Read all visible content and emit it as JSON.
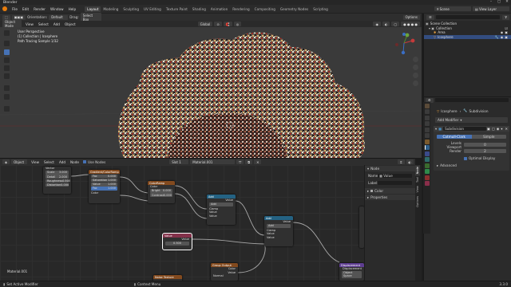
{
  "window": {
    "title": "Blender"
  },
  "menu": [
    "File",
    "Edit",
    "Render",
    "Window",
    "Help"
  ],
  "workspaces": [
    "Layout",
    "Modeling",
    "Sculpting",
    "UV Editing",
    "Texture Paint",
    "Shading",
    "Animation",
    "Rendering",
    "Compositing",
    "Geometry Nodes",
    "Scripting"
  ],
  "active_workspace": "Layout",
  "scene": {
    "label": "Scene",
    "view_layer": "View Layer"
  },
  "viewport_header": {
    "orientation_label": "Orientation:",
    "orientation_value": "Default",
    "drag_label": "Drag:",
    "drag_value": "Select Box",
    "mode": "Object Mode",
    "menus": [
      "View",
      "Select",
      "Add",
      "Object"
    ],
    "transform": "Global",
    "options": "Options"
  },
  "viewport_overlay": {
    "line1": "User Perspective",
    "line2": "(1) Collection | Icosphere",
    "line3": "Path Tracing Sample 1/32"
  },
  "node_header": {
    "editor": "Object",
    "menus": [
      "View",
      "Select",
      "Add",
      "Node"
    ],
    "use_nodes": "Use Nodes",
    "slot": "Slot 1",
    "material": "Material.001"
  },
  "node_editor": {
    "material_label": "Material.001",
    "nodes": {
      "noise": {
        "title": "",
        "rows": [
          [
            "Scale",
            "3.000"
          ],
          [
            "Detail",
            "2.000"
          ],
          [
            "Roughness",
            "0.500"
          ],
          [
            "Distortion",
            "0.000"
          ]
        ],
        "label_top": "Vector"
      },
      "color_ramp": {
        "title": "Gradient/ColorRamp",
        "rows": [
          [
            "Fac",
            "0.000"
          ],
          [
            "Saturation",
            "1.000"
          ],
          [
            "Value",
            "1.000"
          ],
          [
            "Fac",
            "1.000"
          ],
          [
            "Color",
            ""
          ]
        ]
      },
      "ramp2": {
        "title": "ColorRamp",
        "rows": [
          [
            "Color",
            ""
          ],
          [
            "Bright",
            "0.000"
          ],
          [
            "Contrast",
            "0.000"
          ]
        ]
      },
      "math1": {
        "title": "Add",
        "rows": [
          [
            "Value",
            ""
          ],
          [
            "Add",
            ""
          ],
          [
            "Clamp",
            ""
          ],
          [
            "Value",
            ""
          ],
          [
            "Value",
            ""
          ]
        ]
      },
      "math2": {
        "title": "Add",
        "rows": [
          [
            "Value",
            ""
          ],
          [
            "Add",
            ""
          ],
          [
            "Clamp",
            ""
          ],
          [
            "Value",
            ""
          ],
          [
            "Value",
            ""
          ]
        ]
      },
      "value": {
        "title": "Value",
        "rows": [
          [
            "Value",
            ""
          ],
          [
            "",
            "0.500"
          ]
        ]
      },
      "group_out": {
        "title": "Group Output",
        "rows": [
          [
            "Color",
            ""
          ],
          [
            "Value",
            ""
          ],
          [
            "Normal",
            ""
          ]
        ]
      },
      "displacement": {
        "title": "Displacement",
        "rows": [
          [
            "Displacement",
            ""
          ],
          [
            "Object Space",
            ""
          ]
        ]
      },
      "bottom_left": {
        "title": "Noise Texture"
      }
    }
  },
  "n_panel": {
    "section": "Node",
    "name_label": "Name:",
    "name_value": "Value",
    "label_label": "Label:",
    "color_label": "Color",
    "properties": "Properties"
  },
  "n_tabs": [
    "Node",
    "Tool",
    "View",
    "Options"
  ],
  "outliner": {
    "root": "Scene Collection",
    "items": [
      {
        "label": "Collection",
        "selected": false
      },
      {
        "label": "Area",
        "selected": false
      },
      {
        "label": "Icosphere",
        "selected": true
      }
    ]
  },
  "properties": {
    "object": "Icosphere",
    "modifier_crumb": "Subdivision",
    "add_modifier": "Add Modifier",
    "modifier_name": "Subdivision",
    "tabs": [
      "Catmull-Clark",
      "Simple"
    ],
    "active_tab": "Catmull-Clark",
    "levels_viewport_label": "Levels Viewport",
    "levels_viewport": "0",
    "render_label": "Render",
    "render": "2",
    "optimal_display": "Optimal Display",
    "advanced": "Advanced"
  },
  "status": {
    "left": "Set Active Modifier",
    "middle": "Context Menu",
    "version": "3.3.0"
  },
  "colors": {
    "accent": "#4672b5",
    "header_input": "#83314a",
    "header_shader": "#1c7b4a",
    "header_converter": "#246283",
    "header_texture": "#834a1e",
    "header_output": "#5e3d91"
  }
}
